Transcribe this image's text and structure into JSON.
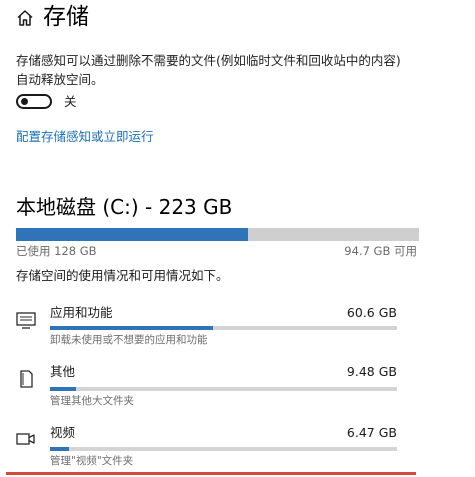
{
  "header": {
    "title": "存储",
    "home_icon": "home-icon"
  },
  "storage_sense": {
    "description": "存储感知可以通过删除不需要的文件(例如临时文件和回收站中的内容)自动释放空间。",
    "toggle_state": "关",
    "toggle_on": false,
    "config_link": "配置存储感知或立即运行"
  },
  "drive": {
    "title": "本地磁盘 (C:) - 223 GB",
    "used_label": "已使用 128 GB",
    "free_label": "94.7 GB 可用",
    "used_fraction": 0.575,
    "usage_intro": "存储空间的使用情况和可用情况如下。"
  },
  "categories": [
    {
      "icon": "monitor-icon",
      "name": "应用和功能",
      "size": "60.6 GB",
      "sub": "卸载未使用或不想要的应用和功能",
      "fraction": 0.47
    },
    {
      "icon": "document-icon",
      "name": "其他",
      "size": "9.48 GB",
      "sub": "管理其他大文件夹",
      "fraction": 0.075
    },
    {
      "icon": "video-camera-icon",
      "name": "视频",
      "size": "6.47 GB",
      "sub": "管理\"视频\"文件夹",
      "fraction": 0.055
    }
  ],
  "colors": {
    "accent": "#2f73b8",
    "link": "#1d6fb8",
    "bar_track": "#cfcfcf",
    "highlight": "#d24b3e"
  }
}
